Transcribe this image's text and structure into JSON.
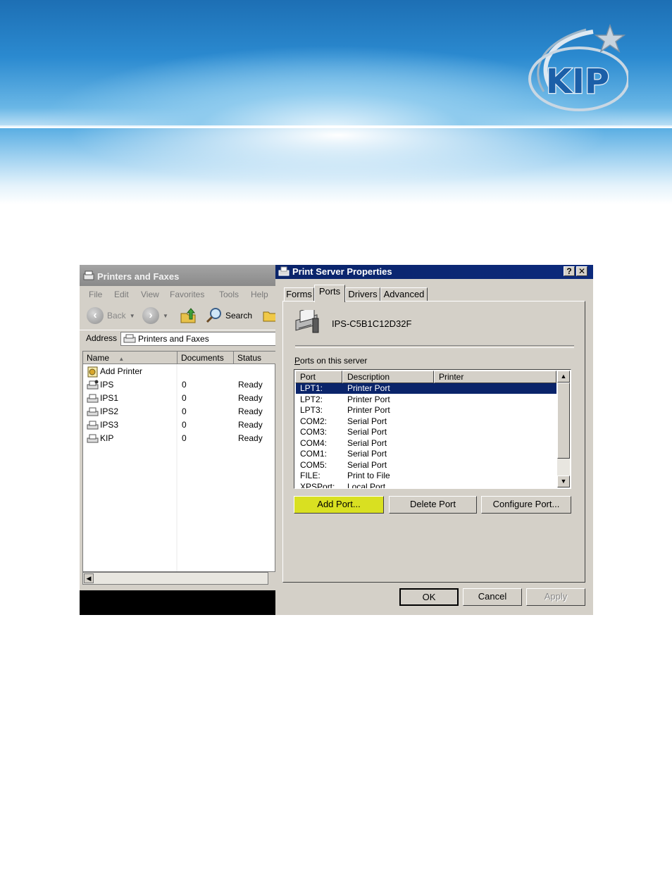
{
  "explorer": {
    "title": "Printers and Faxes",
    "menu": [
      "File",
      "Edit",
      "View",
      "Favorites",
      "Tools",
      "Help"
    ],
    "toolbar": {
      "back_label": "Back",
      "search_label": "Search"
    },
    "address_label": "Address",
    "address_value": "Printers and Faxes",
    "columns": {
      "name": "Name",
      "documents": "Documents",
      "status": "Status"
    },
    "add_printer": "Add Printer",
    "printers": [
      {
        "name": "IPS",
        "documents": "0",
        "status": "Ready"
      },
      {
        "name": "IPS1",
        "documents": "0",
        "status": "Ready"
      },
      {
        "name": "IPS2",
        "documents": "0",
        "status": "Ready"
      },
      {
        "name": "IPS3",
        "documents": "0",
        "status": "Ready"
      },
      {
        "name": "KIP",
        "documents": "0",
        "status": "Ready"
      }
    ]
  },
  "dialog": {
    "title": "Print Server Properties",
    "help_btn": "?",
    "close_btn": "✕",
    "tabs": [
      "Forms",
      "Ports",
      "Drivers",
      "Advanced"
    ],
    "active_tab": "Ports",
    "server_name": "IPS-C5B1C12D32F",
    "ports_label": "Ports on this server",
    "columns": {
      "port": "Port",
      "description": "Description",
      "printer": "Printer"
    },
    "ports": [
      {
        "port": "LPT1:",
        "description": "Printer Port",
        "selected": true
      },
      {
        "port": "LPT2:",
        "description": "Printer Port"
      },
      {
        "port": "LPT3:",
        "description": "Printer Port"
      },
      {
        "port": "COM2:",
        "description": "Serial Port"
      },
      {
        "port": "COM3:",
        "description": "Serial Port"
      },
      {
        "port": "COM4:",
        "description": "Serial Port"
      },
      {
        "port": "COM1:",
        "description": "Serial Port"
      },
      {
        "port": "COM5:",
        "description": "Serial Port"
      },
      {
        "port": "FILE:",
        "description": "Print to File"
      },
      {
        "port": "XPSPort:",
        "description": "Local Port"
      }
    ],
    "buttons": {
      "add_port": "Add Port...",
      "delete_port": "Delete Port",
      "configure_port": "Configure Port...",
      "ok": "OK",
      "cancel": "Cancel",
      "apply": "Apply"
    },
    "highlight_color": "#d9e021"
  },
  "logo_text": "KIP"
}
